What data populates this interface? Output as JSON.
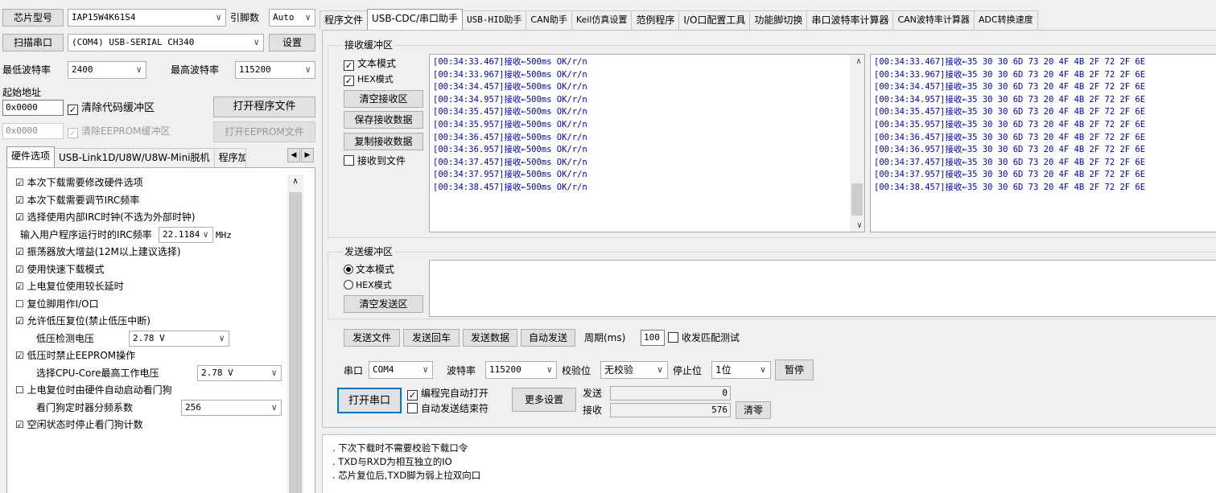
{
  "left": {
    "chip_label": "芯片型号",
    "chip_value": "IAP15W4K61S4",
    "pins_label": "引脚数",
    "pins_value": "Auto",
    "scan_btn": "扫描串口",
    "port_value": "(COM4) USB-SERIAL CH340",
    "settings_btn": "设置",
    "min_baud_label": "最低波特率",
    "min_baud_value": "2400",
    "max_baud_label": "最高波特率",
    "max_baud_value": "115200",
    "start_addr_label": "起始地址",
    "addr1": "0x0000",
    "clear_code_label": "清除代码缓冲区",
    "open_prog_btn": "打开程序文件",
    "addr2": "0x0000",
    "clear_eeprom_label": "清除EEPROM缓冲区",
    "open_eeprom_btn": "打开EEPROM文件",
    "tabs": [
      "硬件选项",
      "USB-Link1D/U8W/U8W-Mini脱机",
      "程序加"
    ],
    "options": [
      {
        "check": "☑",
        "text": "本次下载需要修改硬件选项"
      },
      {
        "check": "☑",
        "text": "本次下载需要调节IRC频率"
      },
      {
        "check": "☑",
        "text": "选择使用内部IRC时钟(不选为外部时钟)"
      },
      {
        "check": "",
        "text": "输入用户程序运行时的IRC频率"
      },
      {
        "check": "☑",
        "text": "振荡器放大增益(12M以上建议选择)"
      },
      {
        "check": "☑",
        "text": "使用快速下载模式"
      },
      {
        "check": "☑",
        "text": "上电复位使用较长延时"
      },
      {
        "check": "☐",
        "text": "复位脚用作I/O口"
      },
      {
        "check": "☑",
        "text": "允许低压复位(禁止低压中断)"
      },
      {
        "check": "",
        "text": "低压检测电压"
      },
      {
        "check": "☑",
        "text": "低压时禁止EEPROM操作"
      },
      {
        "check": "",
        "text": "选择CPU-Core最高工作电压"
      },
      {
        "check": "☐",
        "text": "上电复位时由硬件自动启动看门狗"
      },
      {
        "check": "",
        "text": "看门狗定时器分频系数"
      },
      {
        "check": "☑",
        "text": "空闲状态时停止看门狗计数"
      }
    ],
    "irc_freq": "22.1184",
    "irc_unit": "MHz",
    "lvd_voltage": "2.78 V",
    "core_voltage": "2.78 V",
    "wdt_div": "256"
  },
  "right": {
    "tabs": [
      "程序文件",
      "USB-CDC/串口助手",
      "USB-HID助手",
      "CAN助手",
      "Keil仿真设置",
      "范例程序",
      "I/O口配置工具",
      "功能脚切换",
      "串口波特率计算器",
      "CAN波特率计算器",
      "ADC转换速度"
    ],
    "recv_group": "接收缓冲区",
    "text_mode": "文本模式",
    "hex_mode": "HEX模式",
    "clear_recv": "清空接收区",
    "save_recv": "保存接收数据",
    "copy_recv": "复制接收数据",
    "recv_to_file": "接收到文件",
    "log_text": [
      "[00:34:33.467]接收←500ms OK/r/n",
      "[00:34:33.967]接收←500ms OK/r/n",
      "[00:34:34.457]接收←500ms OK/r/n",
      "[00:34:34.957]接收←500ms OK/r/n",
      "[00:34:35.457]接收←500ms OK/r/n",
      "[00:34:35.957]接收←500ms OK/r/n",
      "[00:34:36.457]接收←500ms OK/r/n",
      "[00:34:36.957]接收←500ms OK/r/n",
      "[00:34:37.457]接收←500ms OK/r/n",
      "[00:34:37.957]接收←500ms OK/r/n",
      "[00:34:38.457]接收←500ms OK/r/n"
    ],
    "log_hex": [
      "[00:34:33.467]接收←35 30 30 6D 73 20 4F 4B 2F 72 2F 6E",
      "[00:34:33.967]接收←35 30 30 6D 73 20 4F 4B 2F 72 2F 6E",
      "[00:34:34.457]接收←35 30 30 6D 73 20 4F 4B 2F 72 2F 6E",
      "[00:34:34.957]接收←35 30 30 6D 73 20 4F 4B 2F 72 2F 6E",
      "[00:34:35.457]接收←35 30 30 6D 73 20 4F 4B 2F 72 2F 6E",
      "[00:34:35.957]接收←35 30 30 6D 73 20 4F 4B 2F 72 2F 6E",
      "[00:34:36.457]接收←35 30 30 6D 73 20 4F 4B 2F 72 2F 6E",
      "[00:34:36.957]接收←35 30 30 6D 73 20 4F 4B 2F 72 2F 6E",
      "[00:34:37.457]接收←35 30 30 6D 73 20 4F 4B 2F 72 2F 6E",
      "[00:34:37.957]接收←35 30 30 6D 73 20 4F 4B 2F 72 2F 6E",
      "[00:34:38.457]接收←35 30 30 6D 73 20 4F 4B 2F 72 2F 6E"
    ],
    "send_group": "发送缓冲区",
    "send_text_mode": "文本模式",
    "send_hex_mode": "HEX模式",
    "clear_send": "清空发送区",
    "send_file": "发送文件",
    "send_cr": "发送回车",
    "send_data": "发送数据",
    "auto_send": "自动发送",
    "period_label": "周期(ms)",
    "period_value": "100",
    "match_test": "收发匹配测试",
    "port_label": "串口",
    "port_value": "COM4",
    "baud_label": "波特率",
    "baud_value": "115200",
    "parity_label": "校验位",
    "parity_value": "无校验",
    "stop_label": "停止位",
    "stop_value": "1位",
    "pause_btn": "暂停",
    "open_port_btn": "打开串口",
    "auto_open": "编程完自动打开",
    "auto_end": "自动发送结束符",
    "more_settings": "更多设置",
    "sent_label": "发送",
    "sent_value": "0",
    "recv_label": "接收",
    "recv_value": "576",
    "clear_count": "清零",
    "notes": [
      ". 下次下载时不需要校验下载口令",
      ". TXD与RXD为相互独立的IO",
      ". 芯片复位后,TXD脚为弱上拉双向口"
    ]
  }
}
